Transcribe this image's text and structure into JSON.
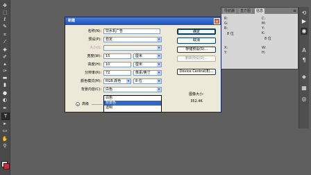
{
  "toolbox": {
    "tools": [
      "move-tool",
      "marquee-tool",
      "lasso-tool",
      "quick-select-tool",
      "crop-tool",
      "eyedropper-tool",
      "healing-tool",
      "brush-tool",
      "clone-stamp-tool",
      "history-brush-tool",
      "eraser-tool",
      "gradient-tool",
      "blur-tool",
      "dodge-tool",
      "pen-tool",
      "type-tool",
      "path-select-tool",
      "shape-tool",
      "hand-tool",
      "zoom-tool"
    ],
    "type_glyph": "T"
  },
  "info_panel": {
    "tabs": [
      {
        "label": "导航器"
      },
      {
        "label": "直方图"
      },
      {
        "label": "信息"
      }
    ],
    "menu_glyph": "≡",
    "values": {
      "r": "R:",
      "g": "G:",
      "b": "B:",
      "bits_left": "8 位",
      "c": "C:",
      "m": "M:",
      "y": "Y:",
      "k": "K:",
      "bits_right": "8 位",
      "x": "X:",
      "y2": "Y:",
      "w": "W:",
      "h": "H:"
    }
  },
  "icon_strip": {
    "icons": [
      "history-panel-icon",
      "actions-panel-icon",
      "layers-panel-icon",
      "channels-panel-icon",
      "paths-panel-icon",
      "color-panel-icon",
      "swatches-panel-icon",
      "styles-panel-icon"
    ]
  },
  "dialog": {
    "title": "新建",
    "close_glyph": "✕",
    "name_label": "名称(N):",
    "name_value": "饮水机广告",
    "preset_label": "预设(P):",
    "preset_value": "自定",
    "size_label": "大小(I):",
    "width_label": "宽度(W):",
    "width_value": "15",
    "width_unit": "厘米",
    "height_label": "高度(H):",
    "height_value": "10",
    "height_unit": "厘米",
    "resolution_label": "分辨率(R):",
    "resolution_value": "72",
    "resolution_unit": "像素/英寸",
    "color_mode_label": "颜色模式(M):",
    "color_mode_value": "RGB 颜色",
    "bit_depth_value": "8 位",
    "bg_label": "背景内容(C):",
    "bg_value": "白色",
    "advanced_label": "高级",
    "dropdown_options": [
      "白色",
      "背景色",
      "透明"
    ],
    "highlighted_option_index": 1,
    "ok_label": "确定",
    "cancel_label": "取消",
    "save_preset_label": "存储预设(S)...",
    "delete_preset_label": "删除预设(D)...",
    "device_central_label": "Device Central(E)...",
    "image_size_label": "图像大小:",
    "image_size_value": "352.4K",
    "arrow_glyph": "▼",
    "advanced_glyph": "»"
  }
}
